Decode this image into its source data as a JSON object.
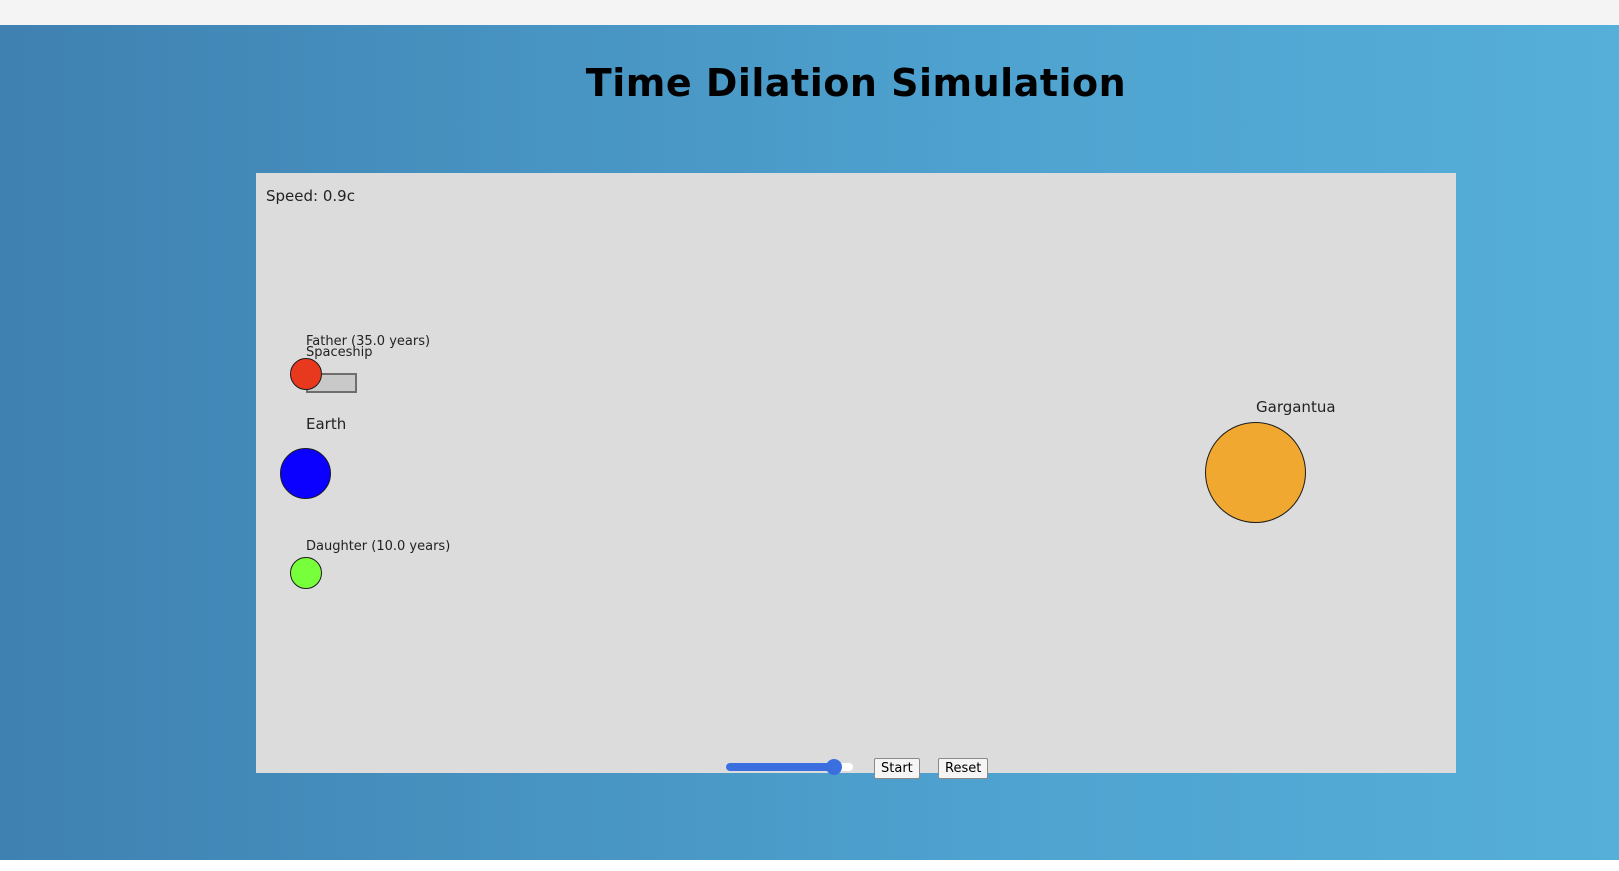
{
  "page": {
    "title": "Time Dilation Simulation"
  },
  "simulation": {
    "speed_text": "Speed: 0.9c",
    "father_label": "Father (35.0 years)",
    "spaceship_label": "Spaceship",
    "earth_label": "Earth",
    "daughter_label": "Daughter (10.0 years)",
    "gargantua_label": "Gargantua",
    "colors": {
      "father": "#e8391f",
      "earth": "#0b00ff",
      "daughter": "#78ff3c",
      "gargantua": "#f0a830",
      "canvas": "#dcdcdc"
    }
  },
  "controls": {
    "speed_slider_value": 0.9,
    "start_label": "Start",
    "reset_label": "Reset"
  }
}
